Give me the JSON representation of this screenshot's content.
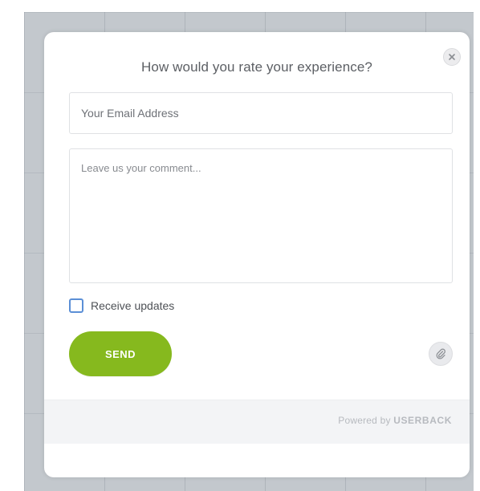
{
  "modal": {
    "title": "How would you rate your experience?",
    "close_icon": "close-icon"
  },
  "form": {
    "email_placeholder": "Your Email Address",
    "email_value": "",
    "comment_placeholder": "Leave us your comment...",
    "comment_value": "",
    "receive_updates_label": "Receive updates",
    "receive_updates_checked": false,
    "send_label": "SEND",
    "attach_icon": "paperclip-icon"
  },
  "footer": {
    "powered_prefix": "Powered by ",
    "brand": "USERBACK"
  },
  "colors": {
    "send_button": "#86b91e",
    "checkbox_border": "#5b8fd6",
    "backdrop": "#c3c8cd"
  }
}
